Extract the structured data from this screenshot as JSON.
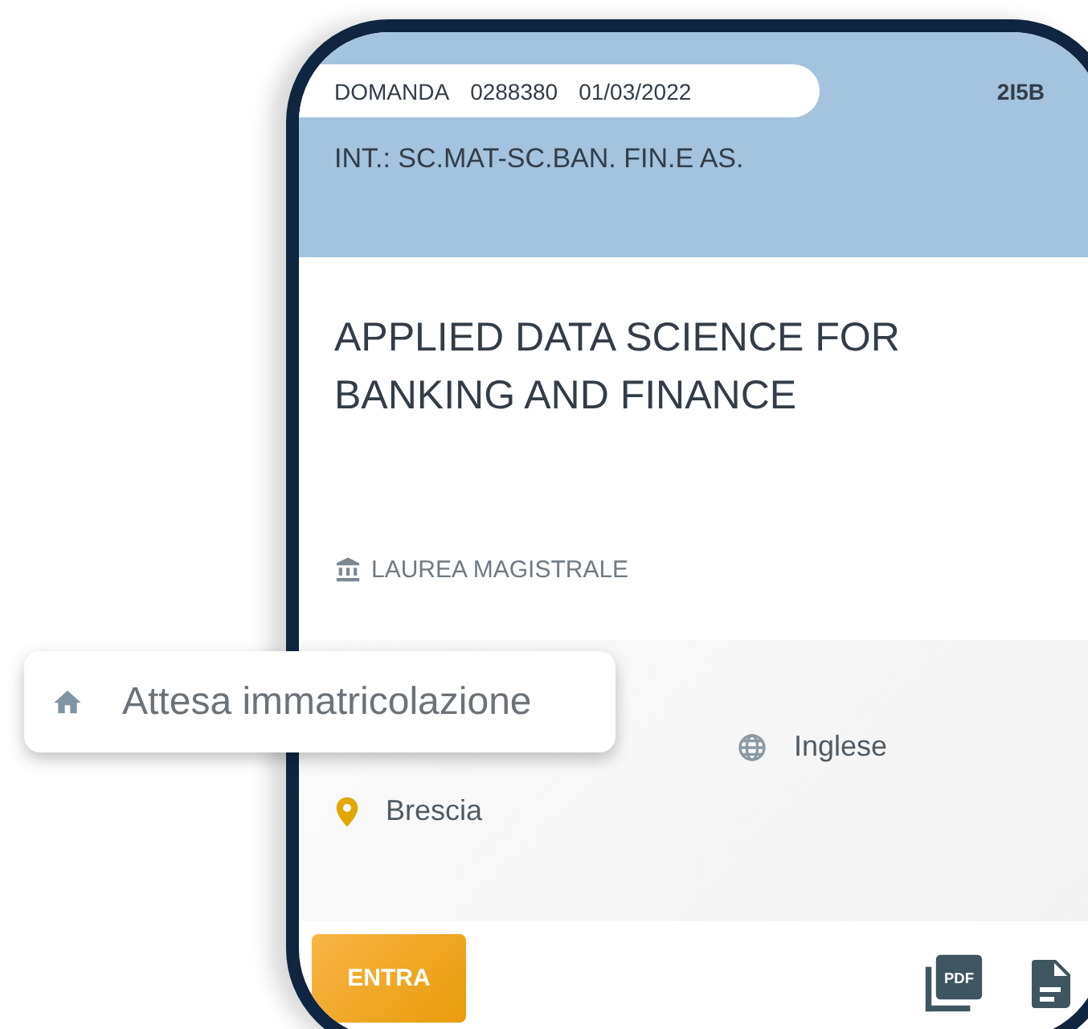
{
  "header": {
    "application_label": "DOMANDA",
    "application_number": "0288380",
    "application_date": "01/03/2022",
    "code": "2I5B",
    "interest": "INT.: SC.MAT-SC.BAN. FIN.E AS."
  },
  "course": {
    "title": "APPLIED DATA SCIENCE FOR BANKING AND FINANCE",
    "degree": "LAUREA MAGISTRALE"
  },
  "details": {
    "language": "Inglese",
    "location": "Brescia"
  },
  "status_chip": {
    "label": "Attesa immatricolazione"
  },
  "actions": {
    "enter_button": "ENTRA",
    "pdf_icon_text": "PDF"
  }
}
